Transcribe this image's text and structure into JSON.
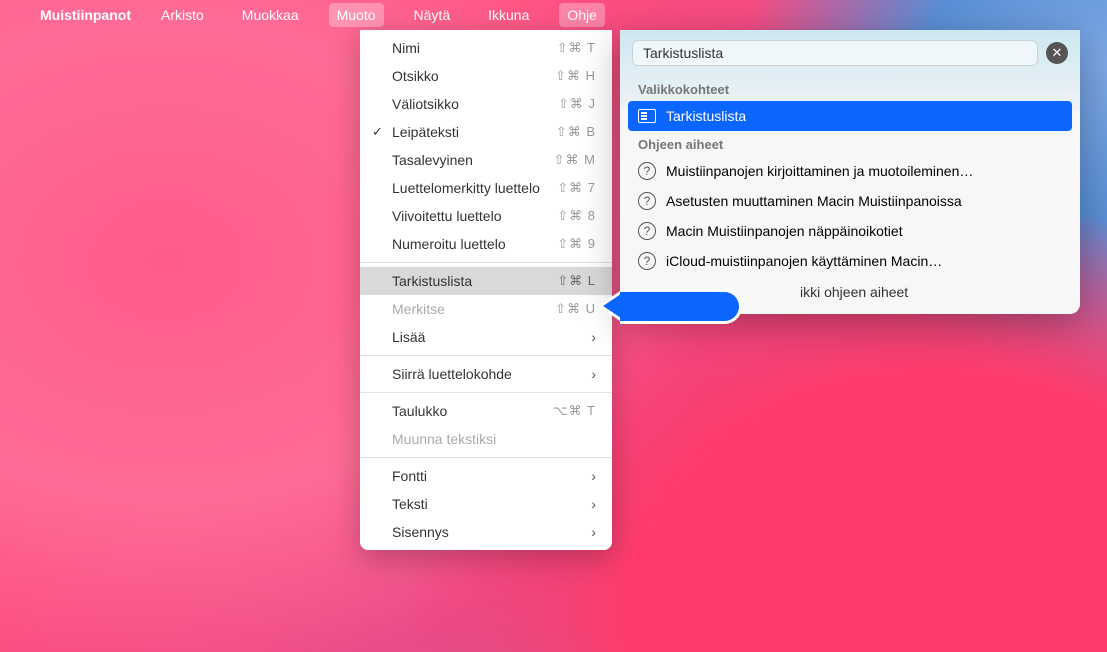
{
  "menubar": {
    "app_name": "Muistiinpanot",
    "items": [
      "Arkisto",
      "Muokkaa",
      "Muoto",
      "Näytä",
      "Ikkuna",
      "Ohje"
    ]
  },
  "format_menu": {
    "items": [
      {
        "label": "Nimi",
        "shortcut": "⇧⌘ T"
      },
      {
        "label": "Otsikko",
        "shortcut": "⇧⌘ H"
      },
      {
        "label": "Väliotsikko",
        "shortcut": "⇧⌘ J"
      },
      {
        "label": "Leipäteksti",
        "shortcut": "⇧⌘ B",
        "checked": true
      },
      {
        "label": "Tasalevyinen",
        "shortcut": "⇧⌘ M"
      },
      {
        "label": "Luettelomerkitty luettelo",
        "shortcut": "⇧⌘ 7"
      },
      {
        "label": "Viivoitettu luettelo",
        "shortcut": "⇧⌘ 8"
      },
      {
        "label": "Numeroitu luettelo",
        "shortcut": "⇧⌘ 9"
      }
    ],
    "group2": [
      {
        "label": "Tarkistuslista",
        "shortcut": "⇧⌘ L",
        "highlight": true
      },
      {
        "label": "Merkitse",
        "shortcut": "⇧⌘ U",
        "disabled": true
      },
      {
        "label": "Lisää",
        "submenu": true
      }
    ],
    "group3": [
      {
        "label": "Siirrä luettelokohde",
        "submenu": true
      }
    ],
    "group4": [
      {
        "label": "Taulukko",
        "shortcut": "⌥⌘ T"
      },
      {
        "label": "Muunna tekstiksi",
        "disabled": true
      }
    ],
    "group5": [
      {
        "label": "Fontti",
        "submenu": true
      },
      {
        "label": "Teksti",
        "submenu": true
      },
      {
        "label": "Sisennys",
        "submenu": true
      }
    ]
  },
  "help": {
    "search_value": "Tarkistuslista",
    "section_menu_items": "Valikkokohteet",
    "menu_hit": "Tarkistuslista",
    "section_topics": "Ohjeen aiheet",
    "topics": [
      "Muistiinpanojen kirjoittaminen ja muotoileminen…",
      "Asetusten muuttaminen Macin Muistiinpanoissa",
      "Macin Muistiinpanojen näppäinoikotiet",
      "iCloud-muistiinpanojen käyttäminen Macin…"
    ],
    "more": "ikki ohjeen aiheet"
  }
}
